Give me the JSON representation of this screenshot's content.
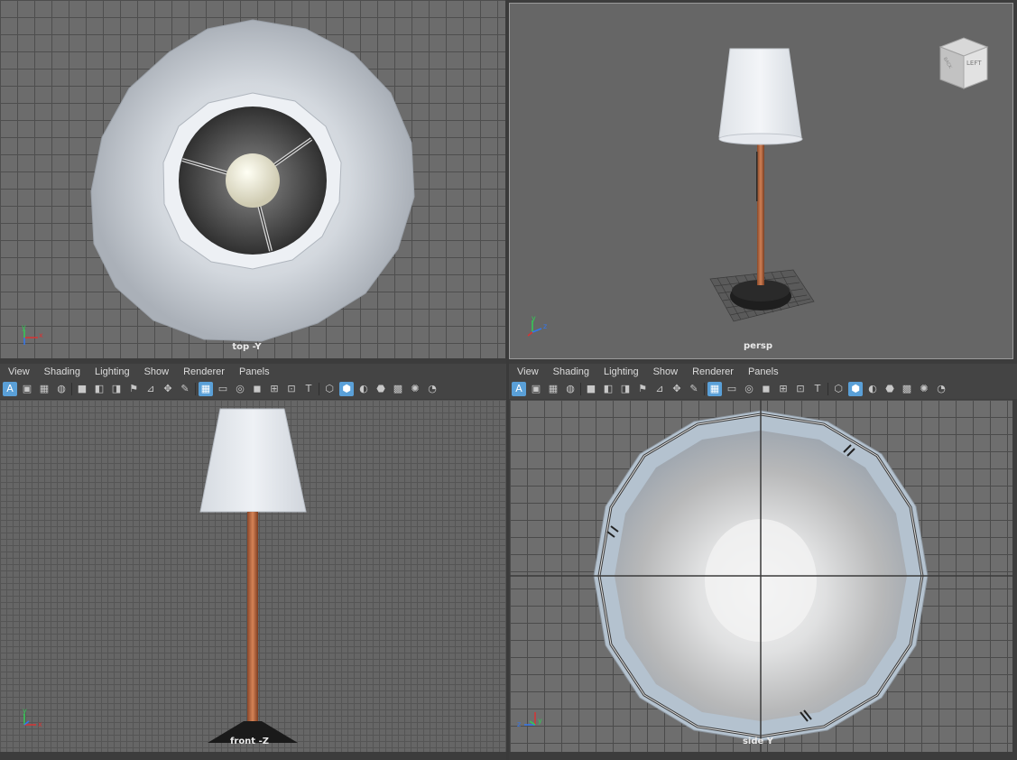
{
  "viewports": {
    "top": {
      "label": "top -Y",
      "axes": [
        "y",
        "x"
      ]
    },
    "persp": {
      "label": "persp",
      "axes": [
        "y",
        "z"
      ],
      "viewcube": {
        "face_left": "LEFT",
        "face_back": "BACK"
      }
    },
    "front": {
      "label": "front -Z",
      "axes": [
        "y",
        "x"
      ]
    },
    "side": {
      "label": "side Y",
      "axes": [
        "z",
        "y"
      ]
    }
  },
  "menus": {
    "left": [
      "View",
      "Shading",
      "Lighting",
      "Show",
      "Renderer",
      "Panels"
    ],
    "right": [
      "View",
      "Shading",
      "Lighting",
      "Show",
      "Renderer",
      "Panels"
    ]
  },
  "toolbar_icons": [
    "select-all-icon",
    "frame-icon",
    "grid-toggle-icon",
    "bookmark-icon",
    "camera-icon",
    "camera-attributes-icon",
    "lock-camera-icon",
    "bookmark-flag-icon",
    "image-plane-icon",
    "pan-zoom-icon",
    "grease-pencil-icon",
    "grid-icon",
    "film-gate-icon",
    "resolution-gate-icon",
    "gate-mask-icon",
    "field-chart-icon",
    "safe-action-icon",
    "safe-title-icon",
    "wireframe-icon",
    "smooth-shade-icon",
    "wireframe-on-shaded-icon",
    "default-material-icon",
    "textured-icon",
    "lights-icon",
    "shadows-icon"
  ],
  "colors": {
    "viewport_bg": "#6c6c6c",
    "panel_bg": "#444444",
    "active_icon": "#5aa0d8",
    "lamp_shade": "#e4e8ee",
    "lamp_pole": "#b56a43",
    "lamp_base": "#1c1c1c",
    "axis_x": "#d93333",
    "axis_y": "#33cc55",
    "axis_z": "#3377ee"
  }
}
